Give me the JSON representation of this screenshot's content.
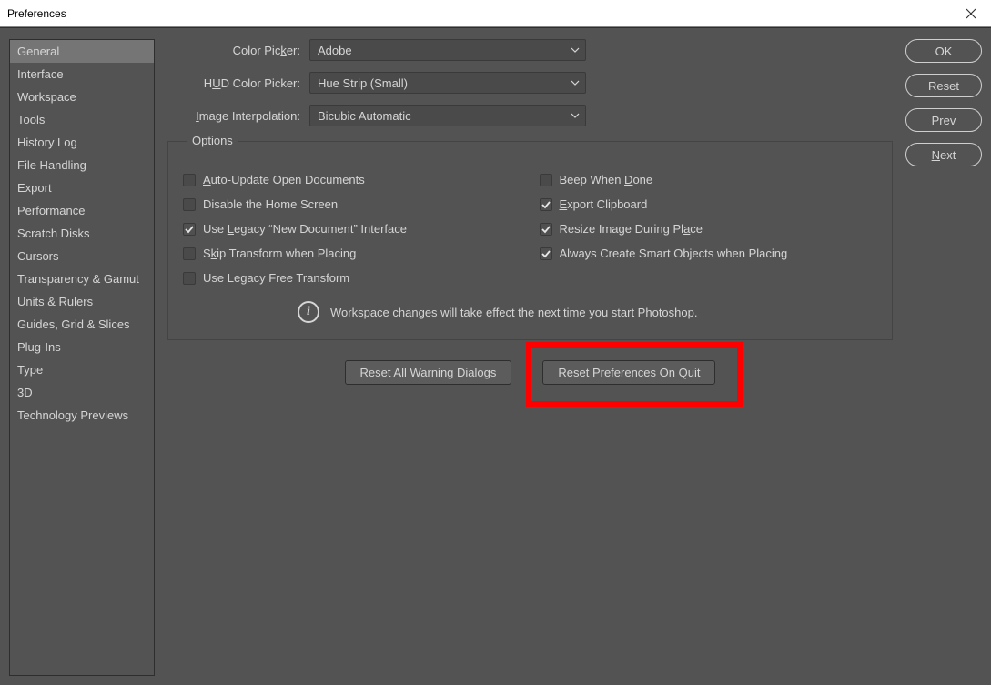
{
  "window": {
    "title": "Preferences"
  },
  "sidebar": {
    "items": [
      "General",
      "Interface",
      "Workspace",
      "Tools",
      "History Log",
      "File Handling",
      "Export",
      "Performance",
      "Scratch Disks",
      "Cursors",
      "Transparency & Gamut",
      "Units & Rulers",
      "Guides, Grid & Slices",
      "Plug-Ins",
      "Type",
      "3D",
      "Technology Previews"
    ],
    "active_index": 0
  },
  "form": {
    "color_picker": {
      "label_pre": "Color Pic",
      "label_u": "k",
      "label_post": "er:",
      "value": "Adobe"
    },
    "hud_color_picker": {
      "label_pre": "H",
      "label_u": "U",
      "label_post": "D Color Picker:",
      "value": "Hue Strip (Small)"
    },
    "image_interpolation": {
      "label_u": "I",
      "label_post": "mage Interpolation:",
      "value": "Bicubic Automatic"
    }
  },
  "options": {
    "legend": "Options",
    "left": [
      {
        "checked": false,
        "pre": "",
        "u": "A",
        "post": "uto-Update Open Documents"
      },
      {
        "checked": false,
        "pre": "Disable the Home Screen",
        "u": "",
        "post": ""
      },
      {
        "checked": true,
        "pre": "Use ",
        "u": "L",
        "post": "egacy “New Document” Interface"
      },
      {
        "checked": false,
        "pre": "S",
        "u": "k",
        "post": "ip Transform when Placing"
      },
      {
        "checked": false,
        "pre": "Use Legacy Free Transform",
        "u": "",
        "post": ""
      }
    ],
    "right": [
      {
        "checked": false,
        "pre": "Beep When ",
        "u": "D",
        "post": "one"
      },
      {
        "checked": true,
        "pre": "",
        "u": "E",
        "post": "xport Clipboard"
      },
      {
        "checked": true,
        "pre": "Resize Image During Pl",
        "u": "a",
        "post": "ce"
      },
      {
        "checked": true,
        "pre": "Always Create Smart Ob",
        "u": "j",
        "post": "ects when Placing"
      }
    ],
    "info": "Workspace changes will take effect the next time you start Photoshop."
  },
  "buttons": {
    "reset_warnings_pre": "Reset All ",
    "reset_warnings_u": "W",
    "reset_warnings_post": "arning Dialogs",
    "reset_on_quit": "Reset Preferences On Quit"
  },
  "rightcol": {
    "ok": "OK",
    "reset": "Reset",
    "prev_u": "P",
    "prev_post": "rev",
    "next_u": "N",
    "next_post": "ext"
  }
}
